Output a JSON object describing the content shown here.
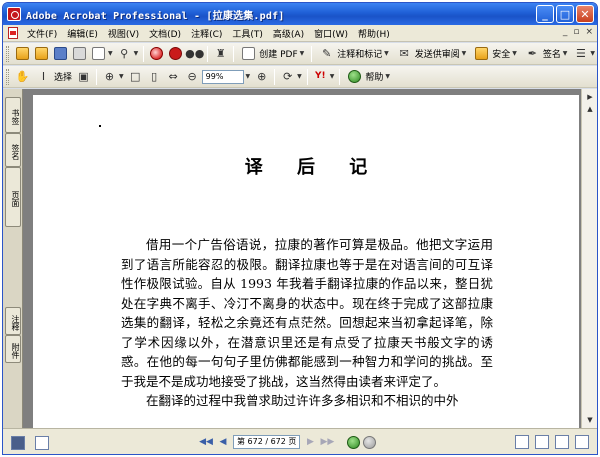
{
  "window": {
    "title": "Adobe Acrobat Professional - [拉康选集.pdf]",
    "controls": {
      "minimize": "_",
      "maximize": "□",
      "close": "✕"
    }
  },
  "menu": {
    "items": [
      {
        "label": "文件(F)"
      },
      {
        "label": "编辑(E)"
      },
      {
        "label": "视图(V)"
      },
      {
        "label": "文档(D)"
      },
      {
        "label": "注释(C)"
      },
      {
        "label": "工具(T)"
      },
      {
        "label": "高级(A)"
      },
      {
        "label": "窗口(W)"
      },
      {
        "label": "帮助(H)"
      }
    ],
    "doc_controls": {
      "minimize": "_",
      "restore": "▫",
      "close": "×"
    }
  },
  "toolbar1": {
    "create_pdf": "创建 PDF",
    "review_comment": "注释和标记",
    "send_review": "发送供审阅",
    "security": "安全",
    "sign": "签名"
  },
  "toolbar2": {
    "select_label": "选择",
    "zoom_value": "99%",
    "help_label": "帮助",
    "yahoo": "Y!"
  },
  "nav_tabs": {
    "bookmarks": "书签",
    "signatures": "签名",
    "pages": "页面",
    "comments": "注释",
    "attachments": "附件"
  },
  "document": {
    "title": "译 后 记",
    "paragraphs": [
      "借用一个广告俗语说，拉康的著作可算是极品。他把文字运用到了语言所能容忍的极限。翻译拉康也等于是在对语言间的可互译性作极限试验。自从 1993 年我着手翻译拉康的作品以来，整日犹处在字典不离手、冷汀不离身的状态中。现在终于完成了这部拉康选集的翻译，轻松之余竟还有点茫然。回想起来当初拿起译笔，除了学术因缘以外，在潜意识里还是有点受了拉康天书般文字的诱惑。在他的每一句句子里仿佛都能感到一种智力和学问的挑战。至于我是不是成功地接受了挑战，这当然得由读者来评定了。",
      "在翻译的过程中我曾求助过许许多多相识和不相识的中外"
    ]
  },
  "status": {
    "page_display": "第 672 / 672 页",
    "nav": {
      "first": "◀◀",
      "prev": "◀",
      "next": "▶",
      "last": "▶▶"
    }
  }
}
